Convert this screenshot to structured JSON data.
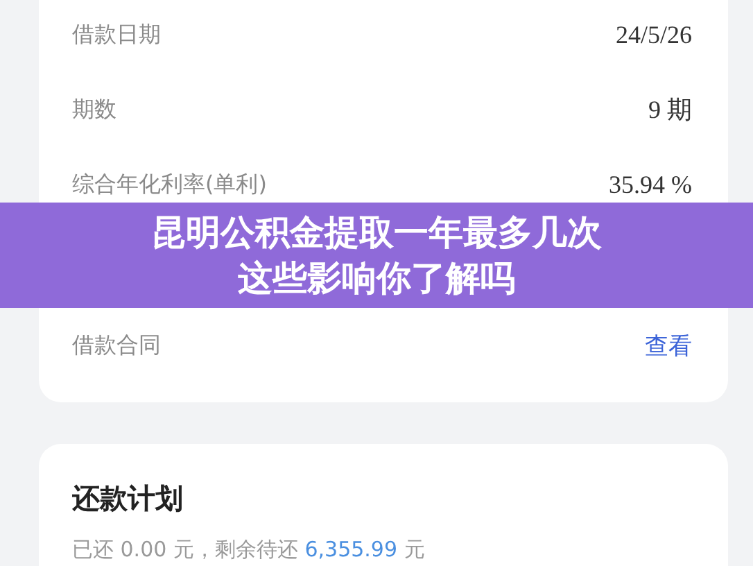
{
  "loan_details": {
    "rows": [
      {
        "label": "借款日期",
        "value": "24/5/26",
        "kind": "text"
      },
      {
        "label": "期数",
        "value": "9 期",
        "kind": "text"
      },
      {
        "label": "综合年化利率(单利)",
        "value": "35.94 %",
        "kind": "text"
      },
      {
        "label": "借款合同",
        "value": "查看",
        "kind": "link"
      }
    ]
  },
  "banner": {
    "lines": [
      "昆明公积金提取一年最多几次",
      "这些影响你了解吗"
    ]
  },
  "repayment_plan": {
    "title": "还款计划",
    "paid_prefix": "已还 0.00 元，剩余待还",
    "remaining": "6,355.99",
    "unit": "元"
  }
}
